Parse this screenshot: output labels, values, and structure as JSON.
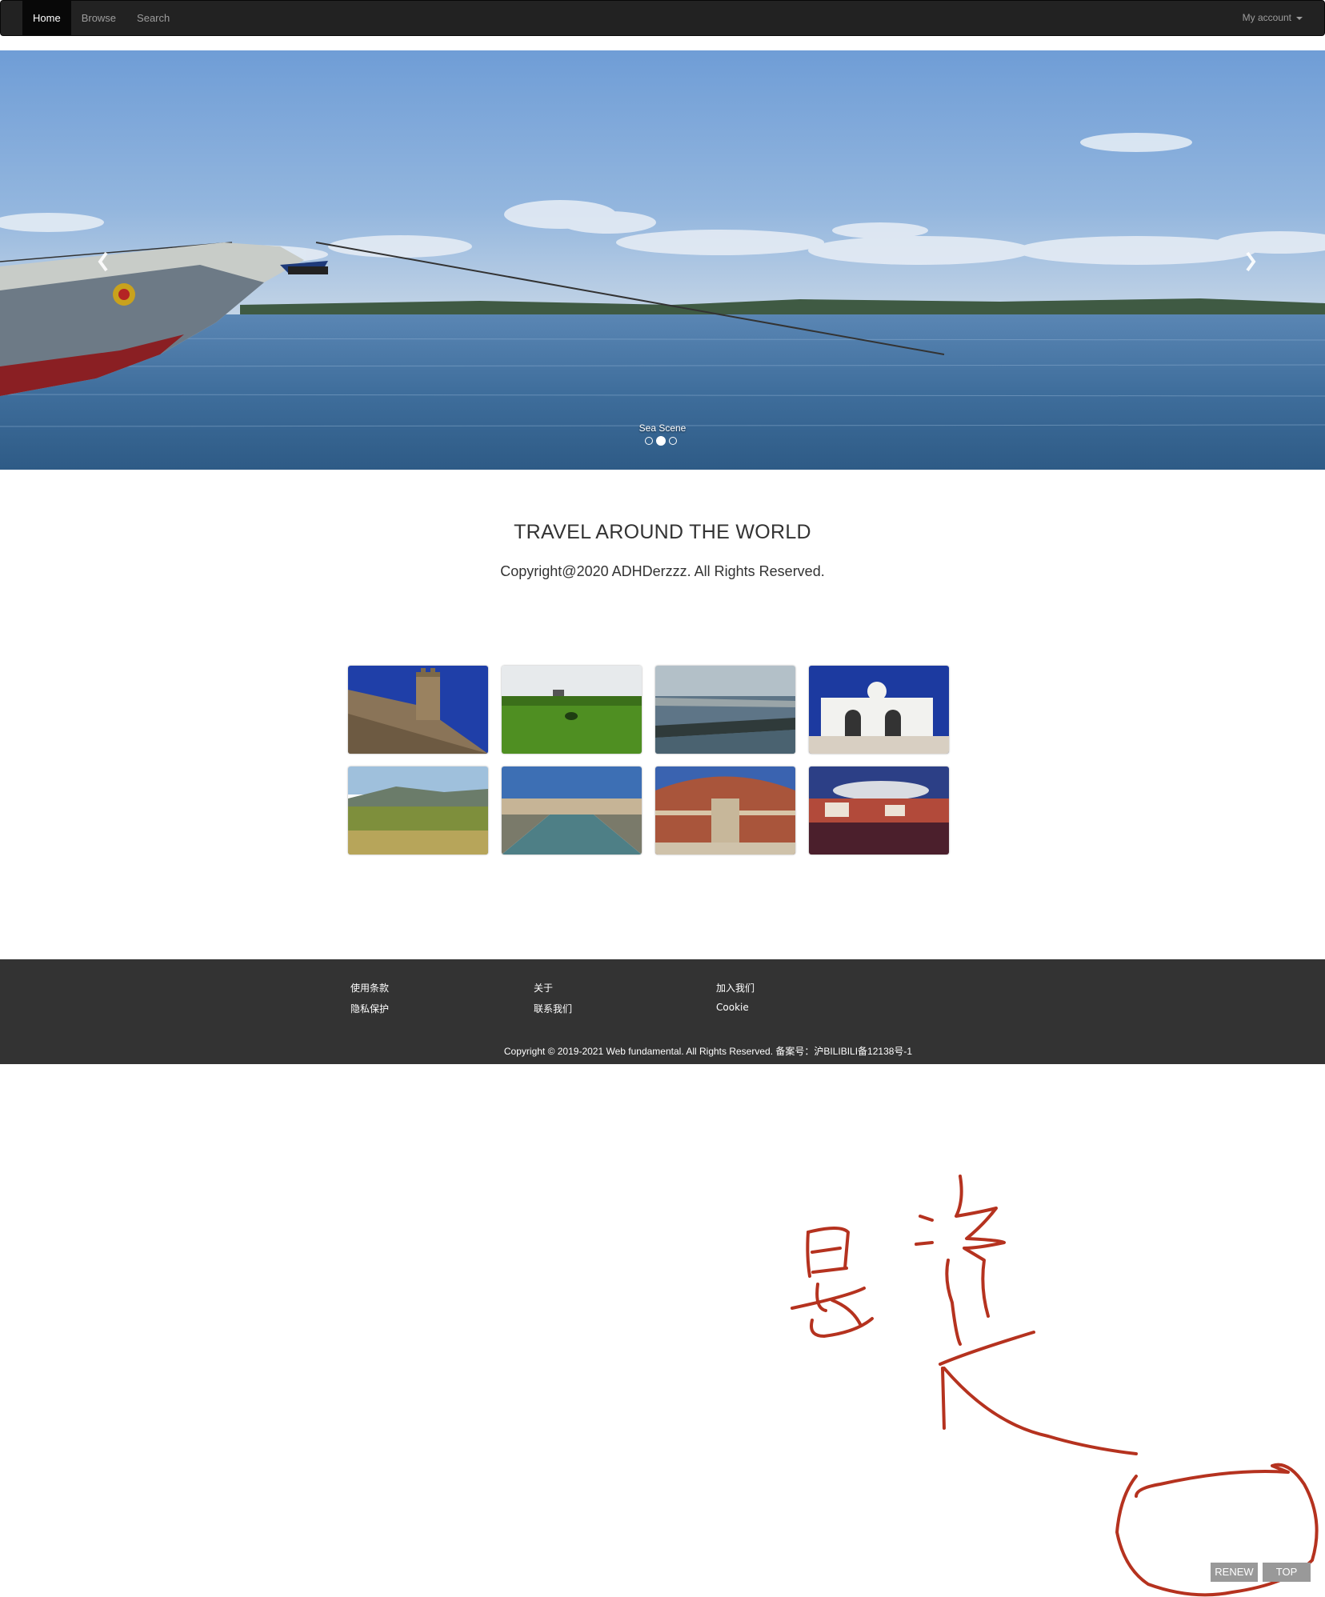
{
  "navbar": {
    "items": [
      {
        "label": "Home",
        "active": true
      },
      {
        "label": "Browse",
        "active": false
      },
      {
        "label": "Search",
        "active": false
      }
    ],
    "account_label": "My account"
  },
  "carousel": {
    "caption": "Sea Scene",
    "slide_count": 3,
    "active_index": 1
  },
  "hero": {
    "title": "TRAVEL AROUND THE WORLD",
    "copyright": "Copyright@2020 ADHDerzzz. All Rights Reserved."
  },
  "gallery": {
    "items": [
      {
        "subject": "castle-tower"
      },
      {
        "subject": "green-field"
      },
      {
        "subject": "coastline"
      },
      {
        "subject": "white-church"
      },
      {
        "subject": "hillside-ruins"
      },
      {
        "subject": "canal-city"
      },
      {
        "subject": "royal-albert-hall"
      },
      {
        "subject": "harbor-town"
      }
    ]
  },
  "footer": {
    "col1": [
      "使用条款",
      "隐私保护"
    ],
    "col2": [
      "关于",
      "联系我们"
    ],
    "col3": [
      "加入我们",
      "Cookie"
    ],
    "copyright": "Copyright © 2019-2021 Web fundamental. All Rights Reserved. 备案号：沪BILIBILI备12138号-1"
  },
  "floating": {
    "renew_label": "RENEW",
    "top_label": "TOP",
    "color": "#999999"
  },
  "annotation": {
    "handwritten_text": "悬浮",
    "ink_color": "#b5321f"
  }
}
